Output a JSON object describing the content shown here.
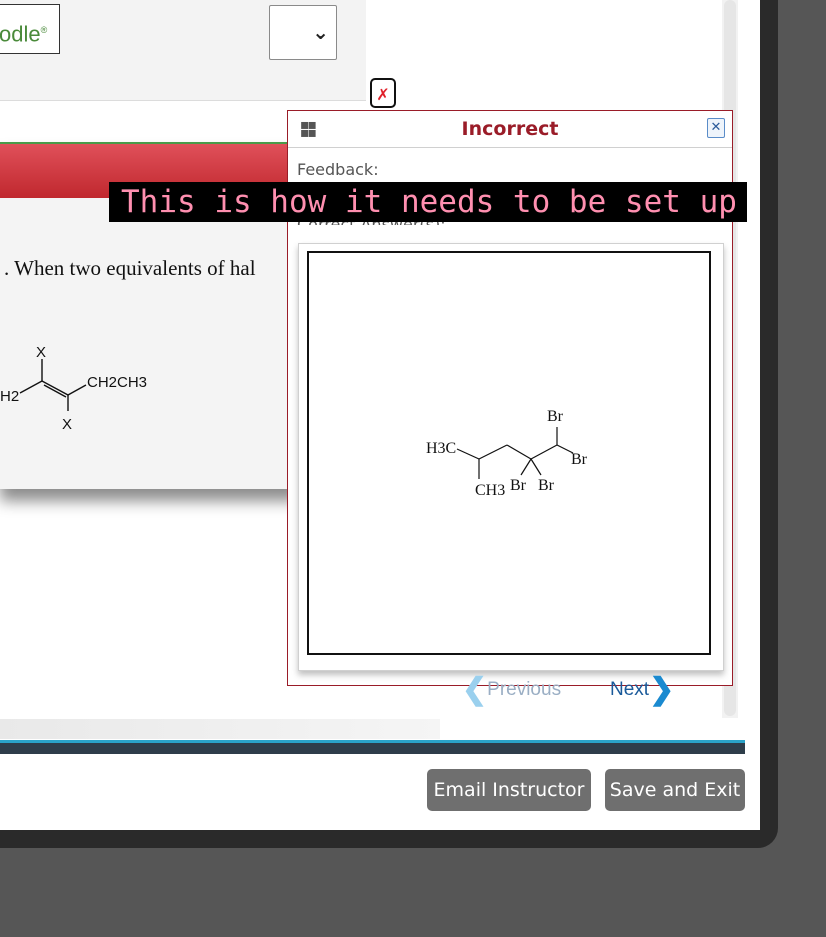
{
  "brand": {
    "partial_name": "odle",
    "mark": "®"
  },
  "question": {
    "partial_text": ". When two equivalents of hal",
    "reactant_fragment_left": "H2",
    "reactant_substituent": "CH2CH3",
    "halogen_symbol": "X"
  },
  "feedback_popup": {
    "title": "Incorrect",
    "close_glyph": "✕",
    "feedback_label": "Feedback:",
    "answer_label": "Correct Answer(s):",
    "structure": {
      "labels": {
        "methyl_left": "H3C",
        "methyl_bottom": "CH3",
        "br1": "Br",
        "br2": "Br",
        "br3": "Br",
        "br4": "Br"
      }
    },
    "nav": {
      "previous_label": "Previous",
      "next_label": "Next"
    }
  },
  "overlay_caption": "This is how it needs to be set up",
  "footer": {
    "email_label": "Email Instructor",
    "save_label": "Save and Exit"
  },
  "icons": {
    "incorrect_marker": "close-icon",
    "dropdown": "chevron-down-icon",
    "drag": "drag-handle-icon"
  },
  "colors": {
    "accent_red": "#9a1c28",
    "banner_red": "#c0282e",
    "link_blue": "#1a5a9a",
    "button_gray": "#6f6f6f",
    "caption_pink": "#ff8fb0"
  }
}
